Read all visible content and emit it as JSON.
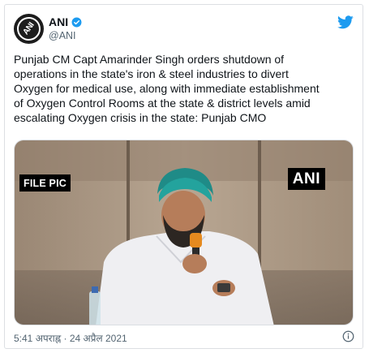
{
  "author": {
    "name": "ANI",
    "handle": "@ANI",
    "avatar_text": "ANI",
    "verified": true
  },
  "tweet": {
    "text": "Punjab CM Capt Amarinder Singh orders shutdown of\noperations in the state's iron & steel industries to divert\nOxygen for medical use, along with immediate establishment\nof Oxygen Control Rooms at the state & district levels amid\nescalating Oxygen crisis in the state: Punjab CMO"
  },
  "media": {
    "left_badge": "FILE PIC",
    "right_badge": "ANI"
  },
  "footer": {
    "timestamp": "5:41 अपराह्न · 24 अप्रैल 2021"
  },
  "icons": {
    "verified": "verified-badge-icon",
    "twitter": "twitter-bird-icon",
    "info": "info-icon"
  },
  "colors": {
    "twitter_blue": "#1d9bf0",
    "text": "#0f1419",
    "muted": "#536471"
  }
}
